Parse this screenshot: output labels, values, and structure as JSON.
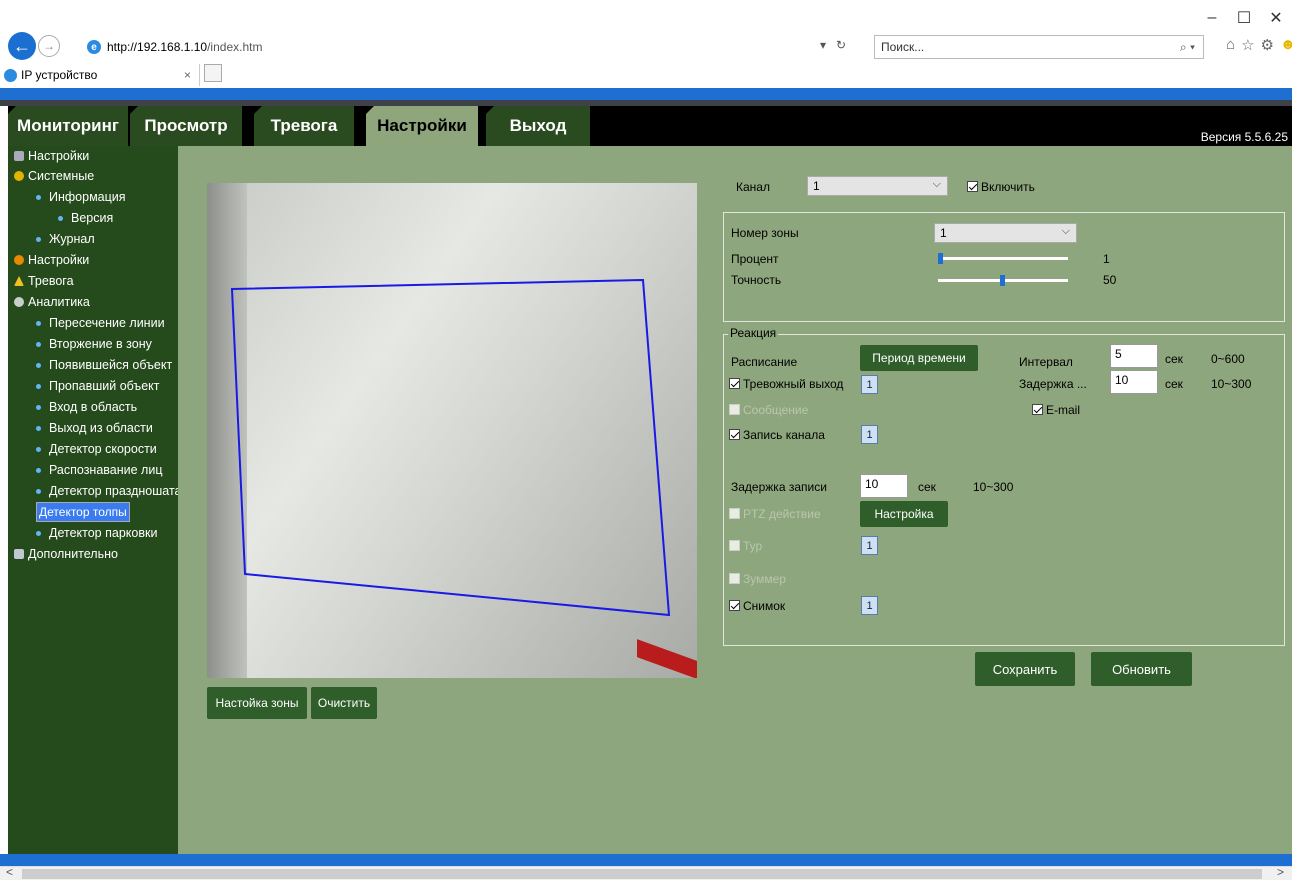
{
  "browser": {
    "url_host": "http://192.168.1.10",
    "url_path": "/index.htm",
    "search_placeholder": "Поиск...",
    "tab_title": "IP устройство"
  },
  "nav": {
    "tabs": [
      "Мониторинг",
      "Просмотр",
      "Тревога",
      "Настройки",
      "Выход"
    ],
    "active": "Настройки",
    "version": "Версия 5.5.6.25"
  },
  "sidebar": {
    "items": [
      {
        "label": "Настройки",
        "level": 0,
        "icon": "settings-book-icon"
      },
      {
        "label": "Системные",
        "level": 0,
        "icon": "system-icon"
      },
      {
        "label": "Информация",
        "level": 1
      },
      {
        "label": "Версия",
        "level": 2
      },
      {
        "label": "Журнал",
        "level": 1
      },
      {
        "label": "Настройки",
        "level": 0,
        "icon": "gear-icon"
      },
      {
        "label": "Тревога",
        "level": 0,
        "icon": "alarm-icon"
      },
      {
        "label": "Аналитика",
        "level": 0,
        "icon": "analytics-icon"
      },
      {
        "label": "Пересечение линии",
        "level": 1
      },
      {
        "label": "Вторжение в зону",
        "level": 1
      },
      {
        "label": "Появившейся объект",
        "level": 1
      },
      {
        "label": "Пропавший объект",
        "level": 1
      },
      {
        "label": "Вход в область",
        "level": 1
      },
      {
        "label": "Выход из области",
        "level": 1
      },
      {
        "label": "Детектор скорости",
        "level": 1
      },
      {
        "label": "Распознавание лиц",
        "level": 1
      },
      {
        "label": "Детектор праздношатающихся",
        "level": 1
      },
      {
        "label": "Детектор толпы",
        "level": 1,
        "selected": true
      },
      {
        "label": "Детектор парковки",
        "level": 1
      },
      {
        "label": "Дополнительно",
        "level": 0,
        "icon": "tools-icon"
      }
    ]
  },
  "video": {
    "zone_button": "Настойка зоны",
    "clear_button": "Очистить"
  },
  "form": {
    "channel_label": "Канал",
    "channel_value": "1",
    "enable_label": "Включить",
    "zone_label": "Номер зоны",
    "zone_value": "1",
    "percent_label": "Процент",
    "percent_value": "1",
    "precision_label": "Точность",
    "precision_value": "50",
    "reaction_legend": "Реакция",
    "schedule_label": "Расписание",
    "schedule_button": "Период времени",
    "interval_label": "Интервал",
    "interval_value": "5",
    "interval_unit": "сек",
    "interval_range": "0~600",
    "alarm_out_label": "Тревожный выход",
    "alarm_out_num": "1",
    "delay_label": "Задержка ...",
    "delay_value": "10",
    "delay_unit": "сек",
    "delay_range": "10~300",
    "message_label": "Сообщение",
    "email_label": "E-mail",
    "record_label": "Запись канала",
    "record_num": "1",
    "rec_delay_label": "Задержка записи",
    "rec_delay_value": "10",
    "rec_delay_unit": "сек",
    "rec_delay_range": "10~300",
    "ptz_label": "PTZ действие",
    "ptz_button": "Настройка",
    "tour_label": "Тур",
    "tour_num": "1",
    "buzzer_label": "Зуммер",
    "snapshot_label": "Снимок",
    "snapshot_num": "1",
    "save_button": "Сохранить",
    "refresh_button": "Обновить"
  },
  "colors": {
    "sidebar_bg": "#254a1b",
    "content_bg": "#8ea67d",
    "button_bg": "#2f5e2a",
    "zone_line": "#1a1ae6"
  }
}
